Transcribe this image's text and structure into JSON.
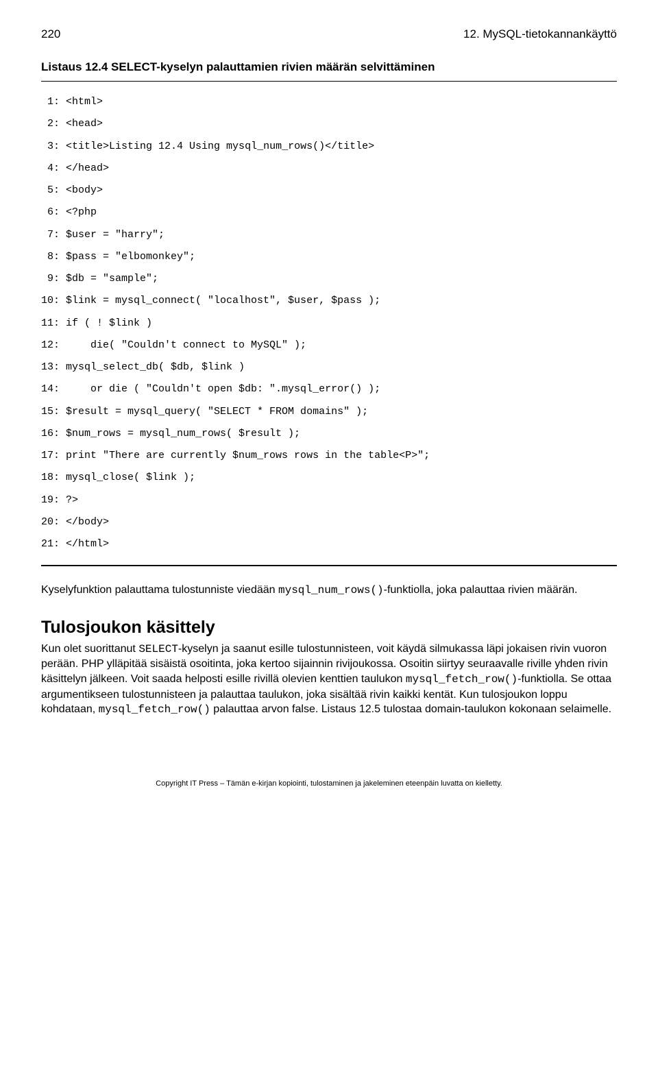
{
  "header": {
    "page_number": "220",
    "chapter": "12. MySQL-tietokannankäyttö"
  },
  "listing": {
    "title": "Listaus 12.4 SELECT-kyselyn palauttamien rivien määrän selvittäminen",
    "code": " 1: <html>\n 2: <head>\n 3: <title>Listing 12.4 Using mysql_num_rows()</title>\n 4: </head>\n 5: <body>\n 6: <?php\n 7: $user = \"harry\";\n 8: $pass = \"elbomonkey\";\n 9: $db = \"sample\";\n10: $link = mysql_connect( \"localhost\", $user, $pass );\n11: if ( ! $link )\n12:     die( \"Couldn't connect to MySQL\" );\n13: mysql_select_db( $db, $link )\n14:     or die ( \"Couldn't open $db: \".mysql_error() );\n15: $result = mysql_query( \"SELECT * FROM domains\" );\n16: $num_rows = mysql_num_rows( $result );\n17: print \"There are currently $num_rows rows in the table<P>\";\n18: mysql_close( $link );\n19: ?>\n20: </body>\n21: </html>"
  },
  "paragraph1": {
    "before": "Kyselyfunktion palauttama tulostunniste viedään ",
    "mono": "mysql_num_rows()",
    "after": "-funktiolla, joka palauttaa rivien määrän."
  },
  "section": {
    "title": "Tulosjoukon käsittely",
    "p": {
      "t1": "Kun olet suorittanut ",
      "m1": "SELECT",
      "t2": "-kyselyn ja saanut esille tulostunnisteen, voit käydä silmukassa läpi jokaisen rivin vuoron perään. PHP ylläpitää sisäistä osoitinta, joka kertoo sijainnin rivijoukossa. Osoitin siirtyy seuraavalle riville yhden rivin käsittelyn jälkeen. Voit saada helposti esille rivillä olevien kenttien taulukon ",
      "m2": "mysql_fetch_row()",
      "t3": "-funktiolla. Se ottaa argumentikseen tulostunnisteen ja palauttaa taulukon, joka sisältää rivin kaikki kentät. Kun tulosjoukon loppu kohdataan, ",
      "m3": "mysql_fetch_row()",
      "t4": " palauttaa arvon false. Listaus 12.5 tulostaa domain-taulukon kokonaan selaimelle."
    }
  },
  "footer": {
    "text": "Copyright IT Press – Tämän e-kirjan kopiointi, tulostaminen ja jakeleminen eteenpäin luvatta on kielletty."
  }
}
